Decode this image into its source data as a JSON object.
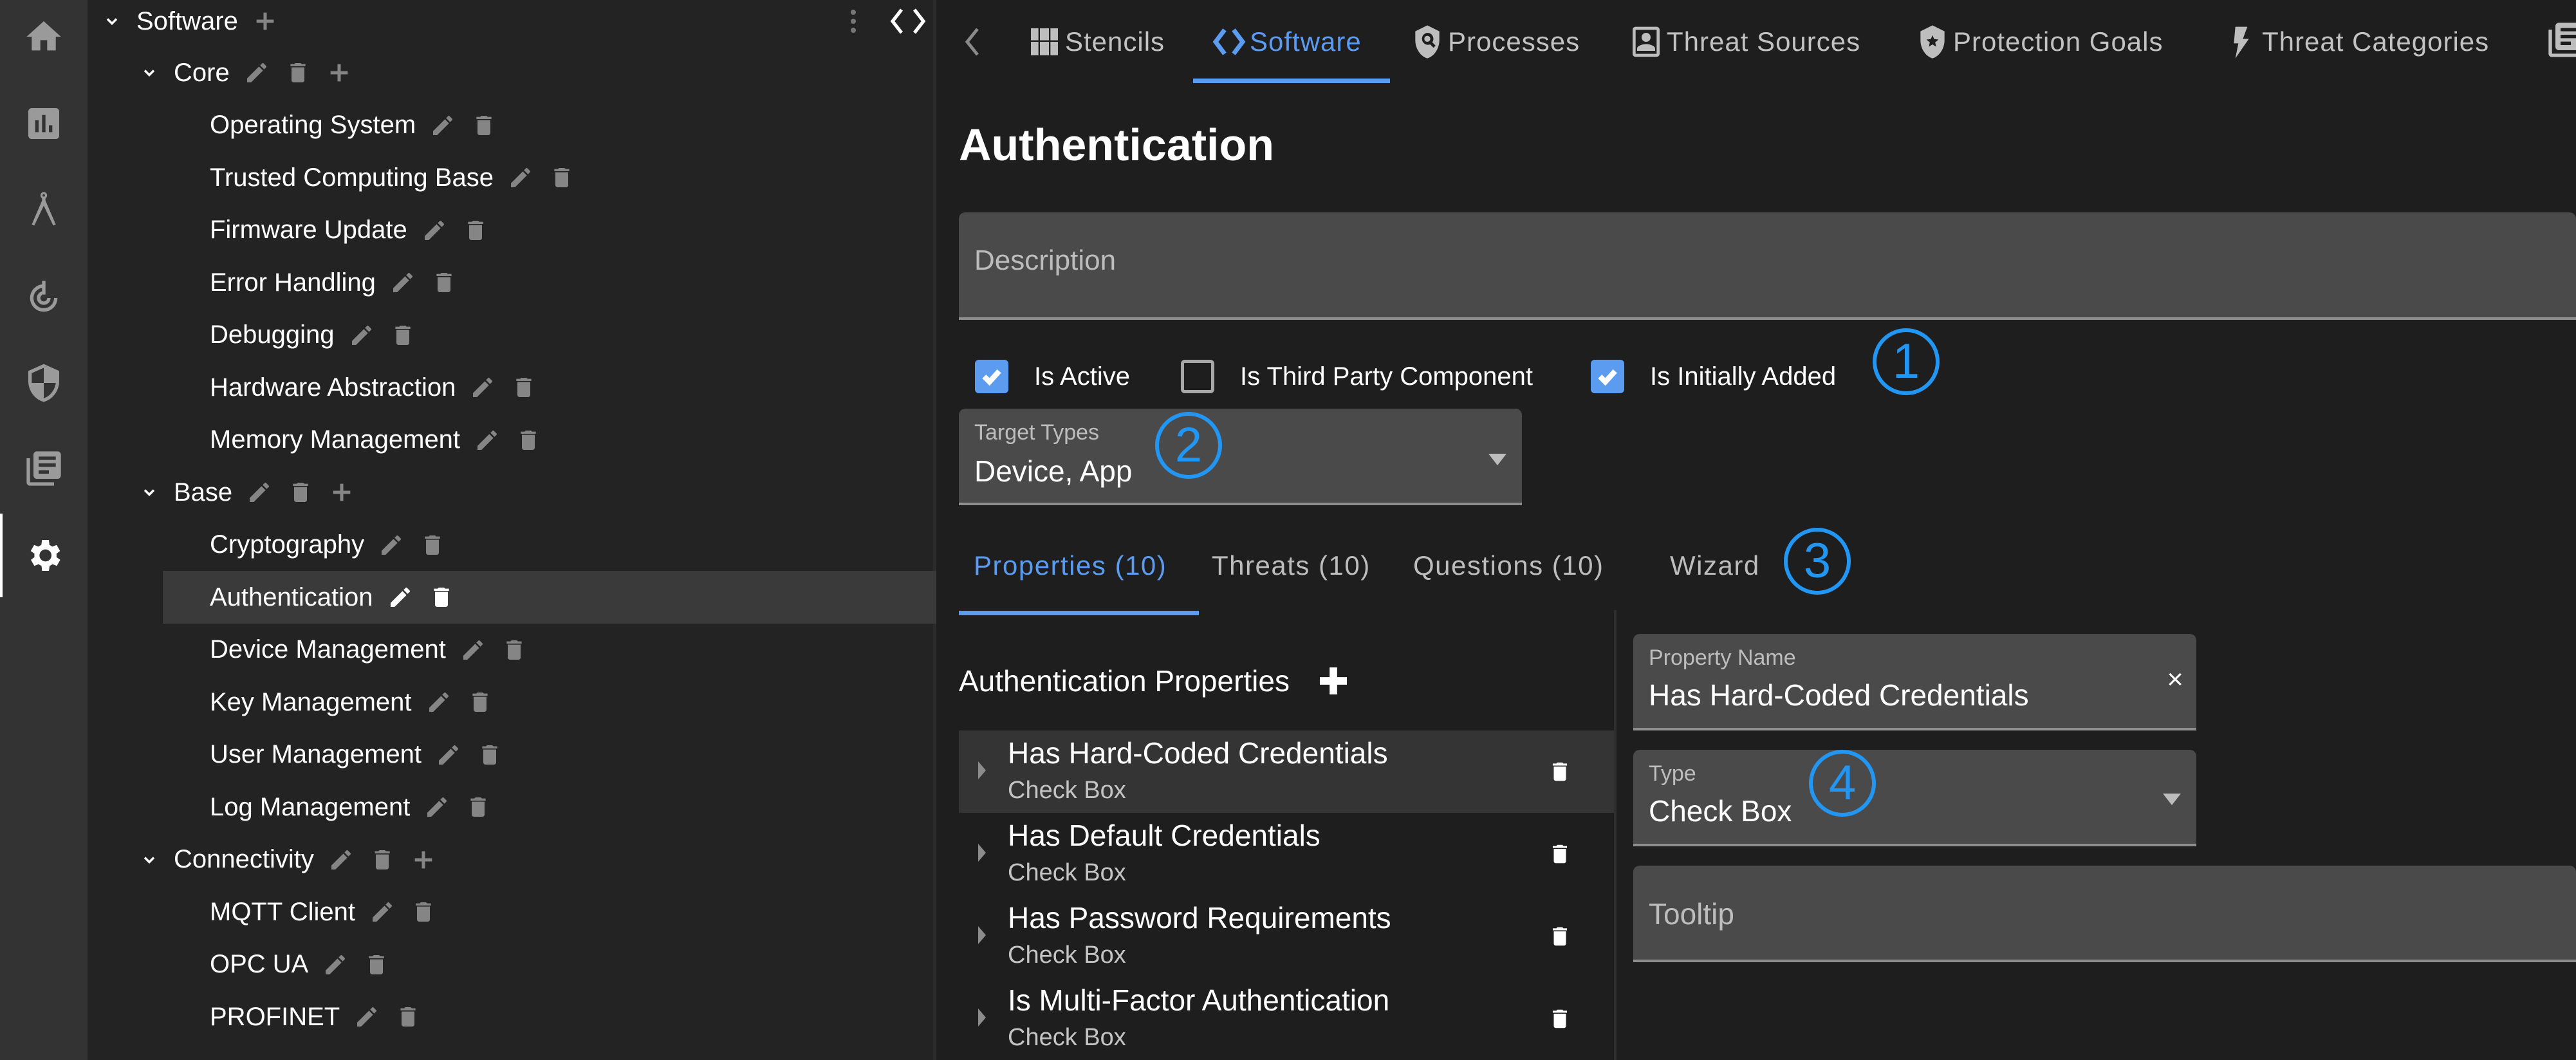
{
  "nav_rail": {
    "items": [
      {
        "icon": "home-icon",
        "label": "Home",
        "active": false
      },
      {
        "icon": "dashboard-chart-icon",
        "label": "Dashboard",
        "active": false
      },
      {
        "icon": "compass-drafting-icon",
        "label": "Design",
        "active": false
      },
      {
        "icon": "target-icon",
        "label": "Threats",
        "active": false
      },
      {
        "icon": "shield-icon",
        "label": "Security",
        "active": false
      },
      {
        "icon": "catalog-icon",
        "label": "Catalog",
        "active": false
      },
      {
        "icon": "gear-icon",
        "label": "Settings",
        "active": true
      }
    ]
  },
  "tree": {
    "root": {
      "label": "Software"
    },
    "groups": [
      {
        "label": "Core",
        "items": [
          "Operating System",
          "Trusted Computing Base",
          "Firmware Update",
          "Error Handling",
          "Debugging",
          "Hardware Abstraction",
          "Memory Management"
        ]
      },
      {
        "label": "Base",
        "items": [
          "Cryptography",
          "Authentication",
          "Device Management",
          "Key Management",
          "User Management",
          "Log Management"
        ]
      },
      {
        "label": "Connectivity",
        "items": [
          "MQTT Client",
          "OPC UA",
          "PROFINET"
        ]
      }
    ],
    "selected": "Authentication"
  },
  "top_tabs": [
    {
      "label": "Stencils",
      "icon": "grid-icon",
      "active": false
    },
    {
      "label": "Software",
      "icon": "code-icon",
      "active": true
    },
    {
      "label": "Processes",
      "icon": "shield-search-icon",
      "active": false
    },
    {
      "label": "Threat Sources",
      "icon": "person-badge-icon",
      "active": false
    },
    {
      "label": "Protection Goals",
      "icon": "shield-star-icon",
      "active": false
    },
    {
      "label": "Threat Categories",
      "icon": "lightning-icon",
      "active": false
    }
  ],
  "editor": {
    "title": "Authentication",
    "description_placeholder": "Description",
    "checkboxes": [
      {
        "label": "Is Active",
        "checked": true
      },
      {
        "label": "Is Third Party Component",
        "checked": false
      },
      {
        "label": "Is Initially Added",
        "checked": true
      }
    ],
    "target_types": {
      "label": "Target Types",
      "value": "Device, App"
    },
    "sub_tabs": [
      {
        "label": "Properties (10)",
        "active": true
      },
      {
        "label": "Threats (10)",
        "active": false
      },
      {
        "label": "Questions (10)",
        "active": false
      },
      {
        "label": "Wizard",
        "active": false
      }
    ],
    "properties_header": "Authentication Properties",
    "properties": [
      {
        "name": "Has Hard-Coded Credentials",
        "type": "Check Box",
        "selected": true
      },
      {
        "name": "Has Default Credentials",
        "type": "Check Box",
        "selected": false
      },
      {
        "name": "Has Password Requirements",
        "type": "Check Box",
        "selected": false
      },
      {
        "name": "Is Multi-Factor Authentication",
        "type": "Check Box",
        "selected": false
      }
    ],
    "property_form": {
      "name_label": "Property Name",
      "name_value": "Has Hard-Coded Credentials",
      "clear_label": "×",
      "type_label": "Type",
      "type_value": "Check Box",
      "tooltip_placeholder": "Tooltip"
    }
  },
  "annotations": [
    "1",
    "2",
    "3",
    "4"
  ],
  "colors": {
    "accent": "#5b9cf0",
    "annotation": "#2196f3",
    "rail_bg": "#333333",
    "tree_bg": "#232323",
    "main_bg": "#1e1e1e",
    "field_bg": "#4a4a4a"
  }
}
